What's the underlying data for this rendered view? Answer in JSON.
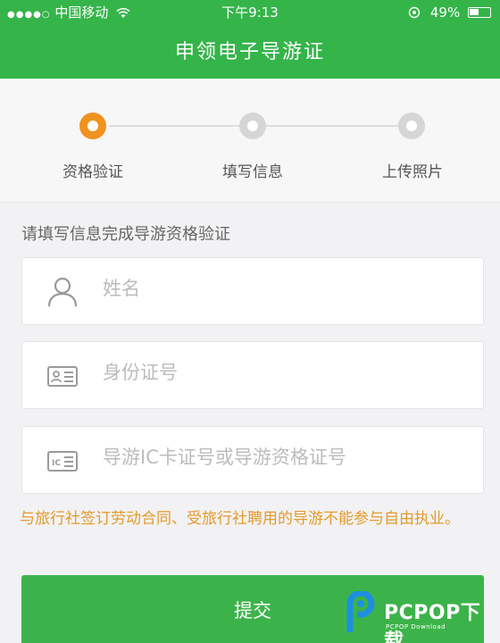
{
  "status_bar": {
    "signal_dots": "●●●●○",
    "carrier": "中国移动",
    "time": "下午9:13",
    "battery": "49%"
  },
  "header": {
    "title": "申领电子导游证"
  },
  "steps": [
    {
      "label": "资格验证",
      "active": true
    },
    {
      "label": "填写信息",
      "active": false
    },
    {
      "label": "上传照片",
      "active": false
    }
  ],
  "form": {
    "hint": "请填写信息完成导游资格验证",
    "name_placeholder": "姓名",
    "id_placeholder": "身份证号",
    "guide_card_placeholder": "导游IC卡证号或导游资格证号",
    "warning": "与旅行社签订劳动合同、受旅行社聘用的导游不能参与自由执业。",
    "submit_label": "提交"
  },
  "watermark": {
    "brand": "PCPOP下载",
    "sub": "PCPOP Download"
  },
  "colors": {
    "brand_green": "#35b44a",
    "step_active": "#f0921e",
    "warning_text": "#e39a2c"
  }
}
